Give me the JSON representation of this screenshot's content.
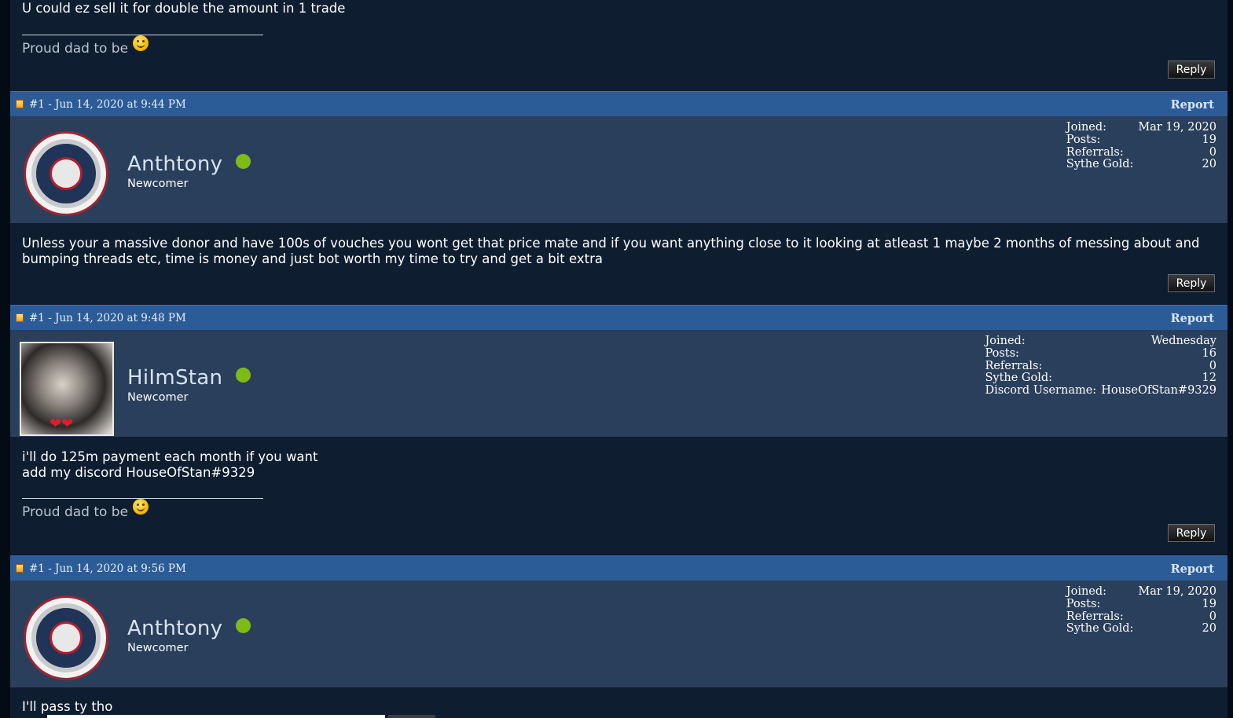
{
  "posts": [
    {
      "text": "U could ez sell it for double the amount in 1 trade",
      "signature": "Proud dad to be",
      "reply_label": "Reply"
    },
    {
      "meta": "#1 - Jun 14, 2020 at 9:44 PM",
      "report_label": "Report",
      "username": "Anthtony",
      "rank": "Newcomer",
      "stats": {
        "joined_label": "Joined:",
        "joined": "Mar 19, 2020",
        "posts_label": "Posts:",
        "posts": "19",
        "referrals_label": "Referrals:",
        "referrals": "0",
        "gold_label": "Sythe Gold:",
        "gold": "20"
      },
      "text": "Unless your a massive donor and have 100s of vouches you wont get that price mate and if you want anything close to it looking at atleast 1 maybe 2 months of messing about and bumping threads etc, time is money and just bot worth my time to try and get a bit extra",
      "reply_label": "Reply"
    },
    {
      "meta": "#1 - Jun 14, 2020 at 9:48 PM",
      "report_label": "Report",
      "username": "HiImStan",
      "rank": "Newcomer",
      "stats": {
        "joined_label": "Joined:",
        "joined": "Wednesday",
        "posts_label": "Posts:",
        "posts": "16",
        "referrals_label": "Referrals:",
        "referrals": "0",
        "gold_label": "Sythe Gold:",
        "gold": "12",
        "discord_label": "Discord Username:",
        "discord": "HouseOfStan#9329"
      },
      "text": "i'll do 125m payment each month if you want\nadd my discord HouseOfStan#9329",
      "signature": "Proud dad to be",
      "reply_label": "Reply"
    },
    {
      "meta": "#1 - Jun 14, 2020 at 9:56 PM",
      "report_label": "Report",
      "username": "Anthtony",
      "rank": "Newcomer",
      "stats": {
        "joined_label": "Joined:",
        "joined": "Mar 19, 2020",
        "posts_label": "Posts:",
        "posts": "19",
        "referrals_label": "Referrals:",
        "referrals": "0",
        "gold_label": "Sythe Gold:",
        "gold": "20"
      },
      "text": "I'll pass ty tho"
    }
  ]
}
